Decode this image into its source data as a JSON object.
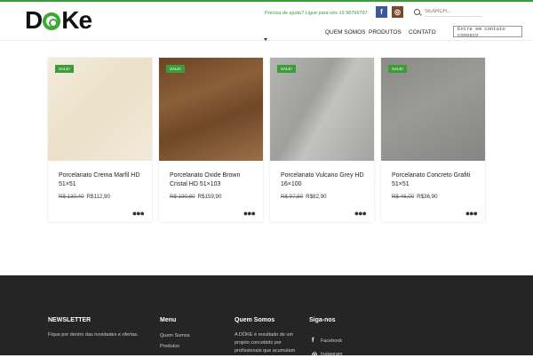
{
  "brand": {
    "logo_text": "DōKe",
    "logo_d": "D",
    "logo_ke": "Ke"
  },
  "header": {
    "helpline": "Precisa de ajuda? Ligue para nós 19 98766797",
    "search_placeholder": "SEARCH...",
    "nav": [
      "QUEM SOMOS",
      "PRODUTOS",
      "CONTATO"
    ],
    "contact_box": "Entre em contato conosco"
  },
  "products": [
    {
      "sale": "SALE!",
      "name": "Porcelanato Crema Marfil HD 51×51",
      "old_price": "R$ 130,40",
      "price": "R$112,90",
      "color": "#efe6d2"
    },
    {
      "sale": "SALE!",
      "name": "Porcelanato Oxide Brown Cristal HD 51×103",
      "old_price": "R$ 190,80",
      "price": "R$159,90",
      "color": "#7a4f2c"
    },
    {
      "sale": "SALE!",
      "name": "Porcelanato Vulcano Grey HD 16×100",
      "old_price": "R$ 97,50",
      "price": "R$82,90",
      "color": "#a9aaa5"
    },
    {
      "sale": "SALE!",
      "name": "Porcelanato Concreto Grafiti 51×51",
      "old_price": "R$ 46,00",
      "price": "R$36,90",
      "color": "#8e8e8c"
    }
  ],
  "footer": {
    "newsletter": {
      "title": "NEWSLETTER",
      "text": "Fique por dentro das novidades e ofertas."
    },
    "menu": {
      "title": "Menu",
      "items": [
        "Quem Somos",
        "Produtos"
      ]
    },
    "quem_somos": {
      "title": "Quem Somos",
      "text_lines": [
        "A DÖKE é resultado de um",
        "projeto concebido por",
        "profissionais que acumulam"
      ]
    },
    "siga": {
      "title": "Siga-nos",
      "facebook": "Facebook",
      "instagram": "Instagram"
    }
  }
}
